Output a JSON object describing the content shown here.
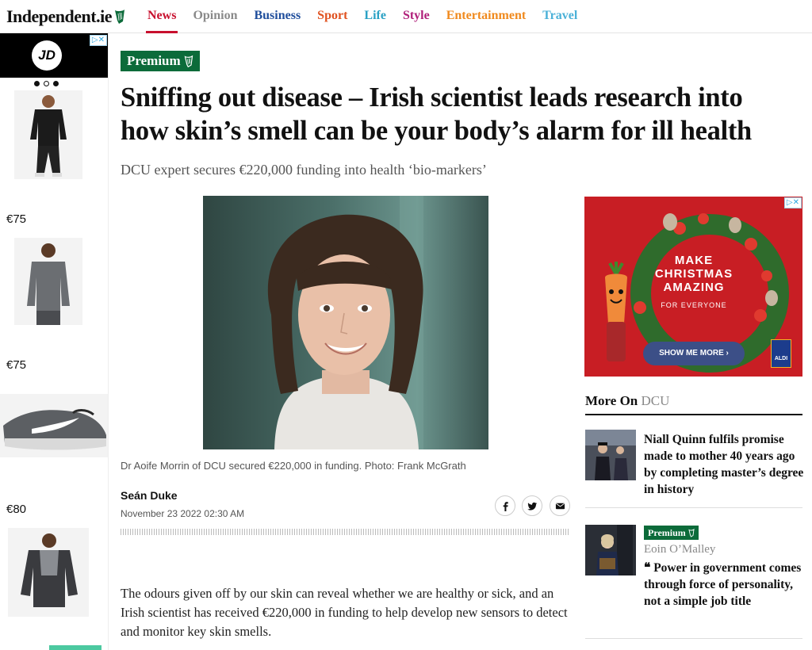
{
  "header": {
    "logo_text": "Independent.ie",
    "nav": [
      {
        "label": "News",
        "color": "#c8102e",
        "active": true
      },
      {
        "label": "Opinion",
        "color": "#8a8a8a"
      },
      {
        "label": "Business",
        "color": "#1f4e9c"
      },
      {
        "label": "Sport",
        "color": "#e0511f"
      },
      {
        "label": "Life",
        "color": "#2aa1c4"
      },
      {
        "label": "Style",
        "color": "#b01f7a"
      },
      {
        "label": "Entertainment",
        "color": "#f08a1e"
      },
      {
        "label": "Travel",
        "color": "#4bb1d8"
      }
    ]
  },
  "left_ad": {
    "brand": "JD",
    "prices": [
      "€75",
      "€75",
      "€80"
    ]
  },
  "article": {
    "premium_label": "Premium",
    "headline": "Sniffing out disease – Irish scientist leads research into how skin’s smell can be your body’s alarm for ill health",
    "standfirst": "DCU expert secures €220,000 funding into health ‘bio-markers’",
    "caption": "Dr Aoife Morrin of DCU secured €220,000 in funding. Photo: Frank McGrath",
    "author": "Seán Duke",
    "date": "November 23 2022 02:30 AM",
    "body": "The odours given off by our skin can reveal whether we are healthy or sick, and an Irish scientist has received €220,000 in funding to help develop new sensors to detect and monitor key skin smells."
  },
  "right_ad": {
    "line1": "MAKE",
    "line2": "CHRISTMAS",
    "line3": "AMAZING",
    "sub": "FOR EVERYONE",
    "cta": "SHOW ME MORE",
    "brand": "ALDI"
  },
  "more_on": {
    "prefix": "More On",
    "topic": "DCU",
    "items": [
      {
        "title": "Niall Quinn fulfils promise made to mother 40 years ago by completing master’s degree in history"
      },
      {
        "premium_label": "Premium",
        "author": "Eoin O’Malley",
        "title": "Power in government comes through force of personality, not a simple job title"
      }
    ]
  },
  "colors": {
    "premium_green": "#0c6b3a",
    "news_red": "#c8102e"
  }
}
